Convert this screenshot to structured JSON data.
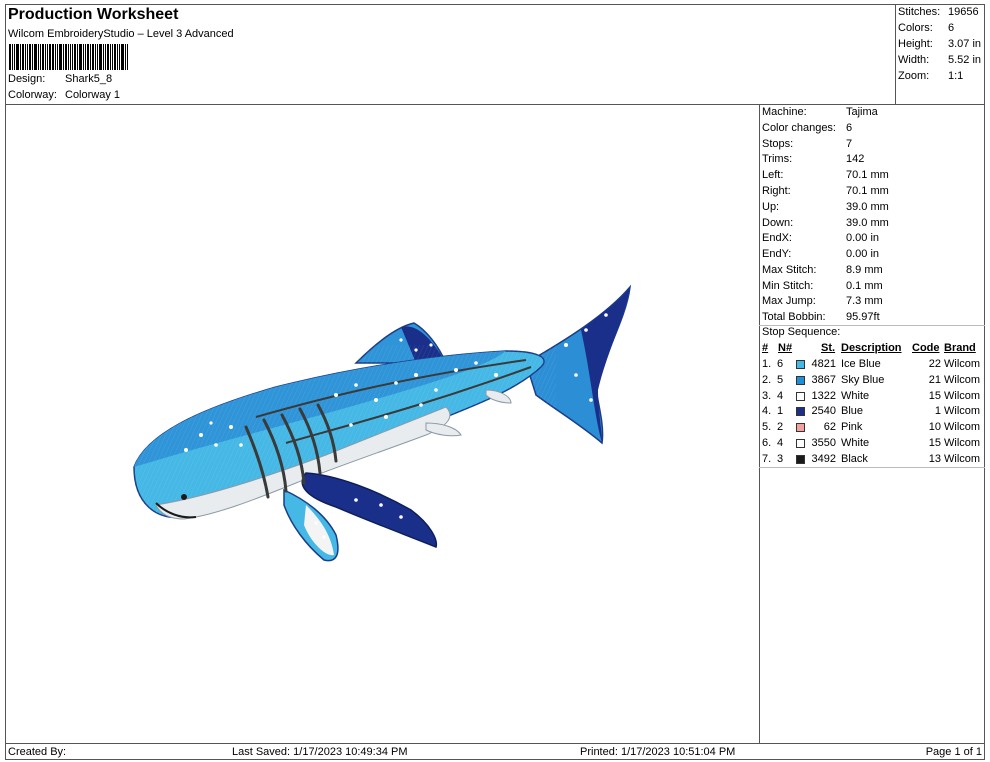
{
  "header": {
    "title": "Production Worksheet",
    "subtitle": "Wilcom EmbroideryStudio – Level 3 Advanced",
    "design_label": "Design:",
    "design_value": "Shark5_8",
    "colorway_label": "Colorway:",
    "colorway_value": "Colorway 1"
  },
  "stats": [
    {
      "label": "Stitches:",
      "value": "19656"
    },
    {
      "label": "Colors:",
      "value": "6"
    },
    {
      "label": "Height:",
      "value": "3.07 in"
    },
    {
      "label": "Width:",
      "value": "5.52 in"
    },
    {
      "label": "Zoom:",
      "value": "1:1"
    }
  ],
  "machine_info": [
    {
      "label": "Machine:",
      "value": "Tajima"
    },
    {
      "label": "Color changes:",
      "value": "6"
    },
    {
      "label": "Stops:",
      "value": "7"
    },
    {
      "label": "Trims:",
      "value": "142"
    },
    {
      "label": "Left:",
      "value": "70.1 mm"
    },
    {
      "label": "Right:",
      "value": "70.1 mm"
    },
    {
      "label": "Up:",
      "value": "39.0 mm"
    },
    {
      "label": "Down:",
      "value": "39.0 mm"
    },
    {
      "label": "EndX:",
      "value": "0.00 in"
    },
    {
      "label": "EndY:",
      "value": "0.00 in"
    },
    {
      "label": "Max Stitch:",
      "value": "8.9 mm"
    },
    {
      "label": "Min Stitch:",
      "value": "0.1 mm"
    },
    {
      "label": "Max Jump:",
      "value": "7.3 mm"
    },
    {
      "label": "Total Bobbin:",
      "value": "95.97ft"
    }
  ],
  "stop_sequence": {
    "title": "Stop Sequence:",
    "headers": {
      "num": "#",
      "n": "N#",
      "st": "St.",
      "desc": "Description",
      "code": "Code",
      "brand": "Brand"
    },
    "rows": [
      {
        "num": "1.",
        "n": "6",
        "st": "4821",
        "desc": "Ice Blue",
        "code": "22",
        "brand": "Wilcom",
        "color": "#45b8e6"
      },
      {
        "num": "2.",
        "n": "5",
        "st": "3867",
        "desc": "Sky Blue",
        "code": "21",
        "brand": "Wilcom",
        "color": "#1f8fd8"
      },
      {
        "num": "3.",
        "n": "4",
        "st": "1322",
        "desc": "White",
        "code": "15",
        "brand": "Wilcom",
        "color": "#ffffff"
      },
      {
        "num": "4.",
        "n": "1",
        "st": "2540",
        "desc": "Blue",
        "code": "1",
        "brand": "Wilcom",
        "color": "#1a2f8a"
      },
      {
        "num": "5.",
        "n": "2",
        "st": "62",
        "desc": "Pink",
        "code": "10",
        "brand": "Wilcom",
        "color": "#f2a0a0"
      },
      {
        "num": "6.",
        "n": "4",
        "st": "3550",
        "desc": "White",
        "code": "15",
        "brand": "Wilcom",
        "color": "#ffffff"
      },
      {
        "num": "7.",
        "n": "3",
        "st": "3492",
        "desc": "Black",
        "code": "13",
        "brand": "Wilcom",
        "color": "#1a1a1a"
      }
    ]
  },
  "footer": {
    "created": "Created By:",
    "saved": "Last Saved: 1/17/2023 10:49:34 PM",
    "printed": "Printed: 1/17/2023 10:51:04 PM",
    "page": "Page 1 of 1"
  }
}
